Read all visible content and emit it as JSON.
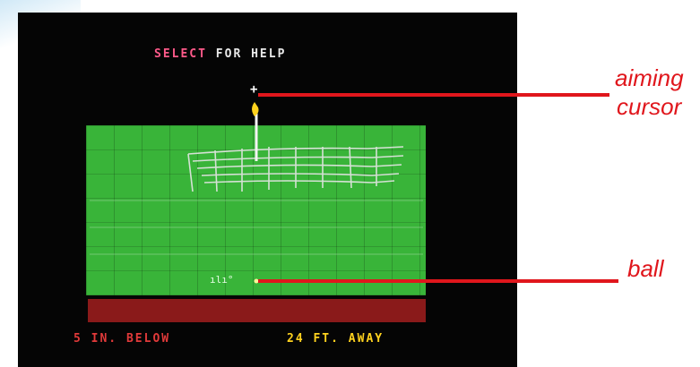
{
  "screen": {
    "prompt_highlight": "SELECT",
    "prompt_rest": " FOR HELP",
    "status_below": "5 IN. BELOW",
    "status_away": "24 FT. AWAY"
  },
  "callouts": {
    "aiming_line1": "aiming",
    "aiming_line2": "cursor",
    "ball": "ball"
  },
  "colors": {
    "green": "#39b439",
    "fringe": "#8a1a1a",
    "callout_red": "#e0161c",
    "prompt_pink": "#ff5a8a",
    "status_red": "#e23a3a",
    "status_yellow": "#ffd21e"
  }
}
